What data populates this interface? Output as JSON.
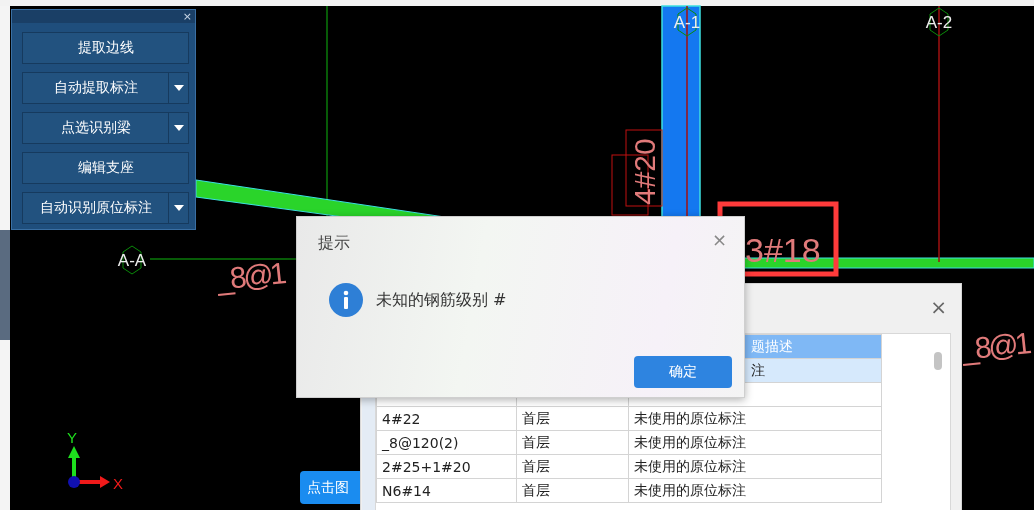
{
  "toolbox": {
    "close": "×",
    "buttons": [
      {
        "label": "提取边线",
        "kind": "plain"
      },
      {
        "label": "自动提取标注",
        "kind": "split"
      },
      {
        "label": "点选识别梁",
        "kind": "split"
      },
      {
        "label": "编辑支座",
        "kind": "plain"
      },
      {
        "label": "自动识别原位标注",
        "kind": "split"
      }
    ]
  },
  "drawing": {
    "axis_labels": [
      "A-1",
      "A-2",
      "A-A"
    ],
    "annotations": [
      {
        "text": "_8@1",
        "kind": "flat"
      },
      {
        "text": "4#20",
        "kind": "vertical"
      },
      {
        "text": "3#18",
        "kind": "highlighted"
      },
      {
        "text": "_8@1",
        "kind": "flat"
      }
    ],
    "coordinate_axes": {
      "x": "X",
      "y": "Y"
    }
  },
  "tooltip": {
    "text": "点击图"
  },
  "result_dialog": {
    "close": "×",
    "columns": [
      "",
      "",
      "题描述"
    ],
    "rows": [
      {
        "selected": true,
        "cells": [
          "",
          "",
          "注"
        ]
      },
      {
        "selected": false,
        "cells": [
          "",
          "",
          ""
        ]
      },
      {
        "selected": false,
        "cells": [
          "4#22",
          "首层",
          "未使用的原位标注"
        ]
      },
      {
        "selected": false,
        "cells": [
          "_8@120(2)",
          "首层",
          "未使用的原位标注"
        ]
      },
      {
        "selected": false,
        "cells": [
          "2#25+1#20",
          "首层",
          "未使用的原位标注"
        ]
      },
      {
        "selected": false,
        "cells": [
          "N6#14",
          "首层",
          "未使用的原位标注"
        ]
      }
    ]
  },
  "alert": {
    "title": "提示",
    "close": "×",
    "message": "未知的钢筋级别 #",
    "button": "确定"
  }
}
